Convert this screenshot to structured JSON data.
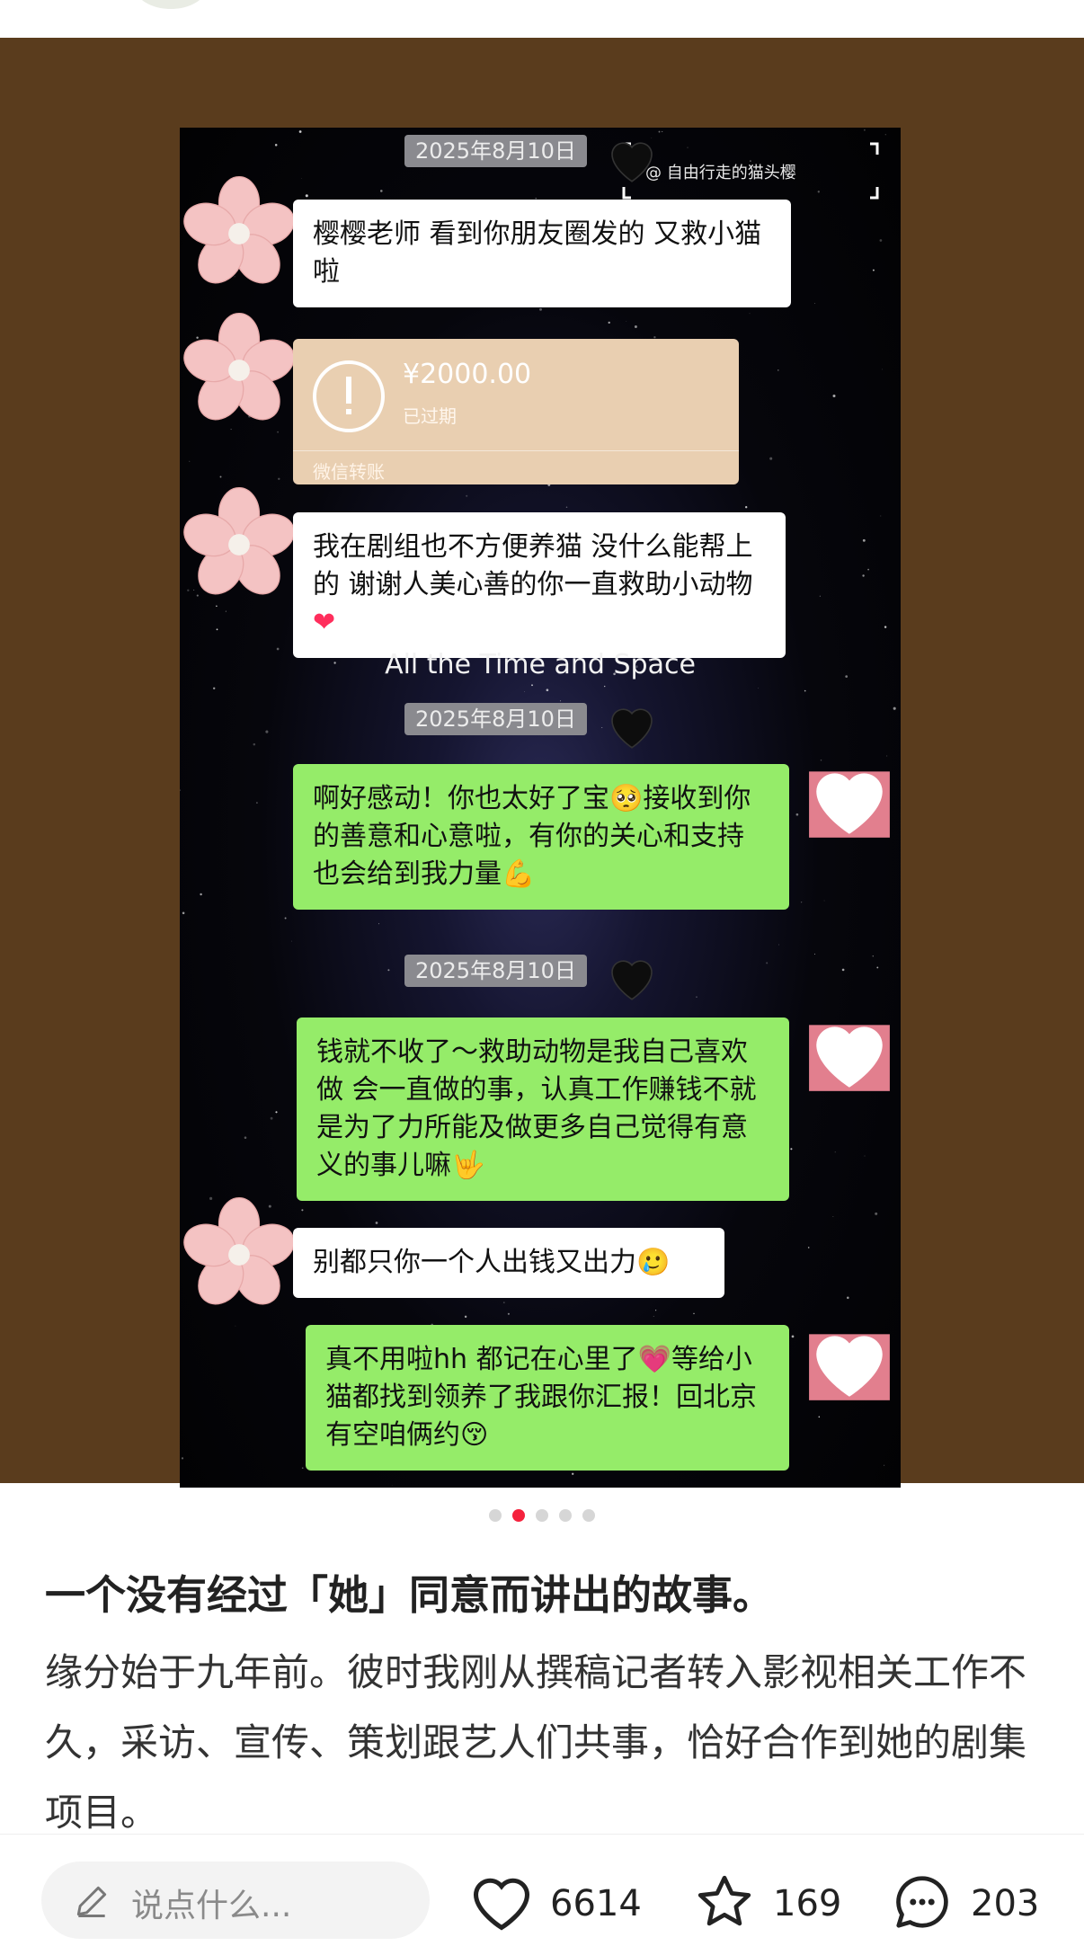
{
  "chat": {
    "date_pills": [
      "2025年8月10日",
      "2025年8月10日",
      "2025年8月10日"
    ],
    "watermark": "@ 自由行走的猫头樱",
    "messages": [
      {
        "side": "left",
        "text": "樱樱老师 看到你朋友圈发的 又救小猫啦"
      },
      {
        "side": "left",
        "text": "我在剧组也不方便养猫 没什么能帮上的 谢谢人美心善的你一直救助小动物",
        "emoji": "heart"
      },
      {
        "side": "right",
        "text": "啊好感动！你也太好了宝",
        "emoji1": "pleading-face",
        "text2": "接收到你的善意和心意啦，有你的关心和支持也会给到我力量",
        "emoji2": "flexed-biceps"
      },
      {
        "side": "right",
        "text": "钱就不收了～救助动物是我自己喜欢做 会一直做的事，认真工作赚钱不就是为了力所能及做更多自己觉得有意义的事儿嘛",
        "emoji": "love-you-gesture"
      },
      {
        "side": "left",
        "text": "别都只你一个人出钱又出力",
        "emoji": "crying-face"
      },
      {
        "side": "right",
        "text": "真不用啦hh 都记在心里了",
        "emoji1": "pink-heart",
        "text2": "等给小猫都找到领养了我跟你汇报！回北京有空咱俩约",
        "emoji2": "kissing-face"
      }
    ],
    "transfer": {
      "amount": "¥2000.00",
      "status": "已过期",
      "kind": "微信转账"
    },
    "overlay_text": "All the Time and Space"
  },
  "carousel": {
    "count": 5,
    "active_index": 1
  },
  "post": {
    "title": "一个没有经过「她」同意而讲出的故事。",
    "body": "缘分始于九年前。彼时我刚从撰稿记者转入影视相关工作不久，采访、宣传、策划跟艺人们共事，恰好合作到她的剧集项目。"
  },
  "bottom_bar": {
    "comment_placeholder": "说点什么...",
    "likes": "6614",
    "favorites": "169",
    "comments": "203"
  },
  "colors": {
    "brown_background": "#5a3c1d",
    "wechat_green": "#95ec69",
    "transfer_beige": "#e9cfb1",
    "active_dot": "#f5223d"
  }
}
